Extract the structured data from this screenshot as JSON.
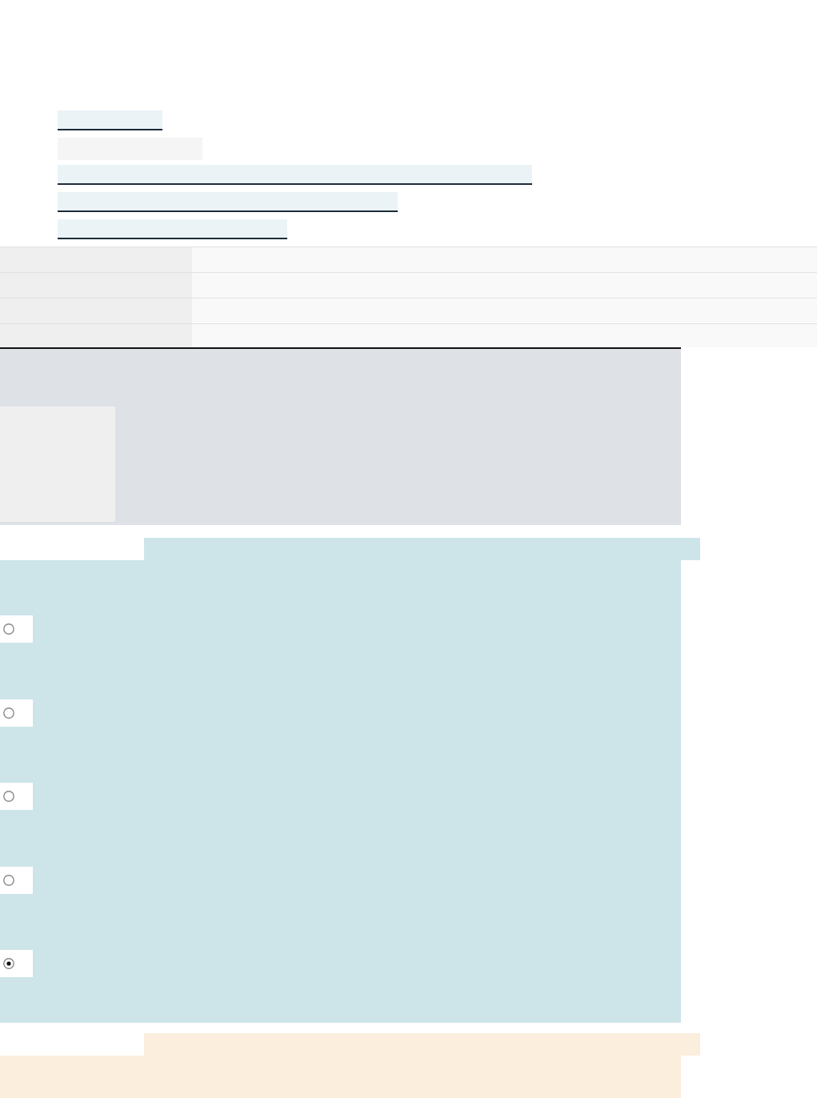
{
  "nav_list": [
    {
      "kind": "link"
    },
    {
      "kind": "plain"
    },
    {
      "kind": "link"
    },
    {
      "kind": "link"
    },
    {
      "kind": "link"
    }
  ],
  "details_table": {
    "rows": [
      {
        "kind": "field"
      },
      {
        "kind": "field"
      },
      {
        "kind": "field"
      },
      {
        "kind": "field"
      }
    ]
  },
  "media_panel": {
    "kind": "image"
  },
  "sections": [
    {
      "kind": "question",
      "options": [
        {
          "selected": false
        },
        {
          "selected": false
        },
        {
          "selected": false
        },
        {
          "selected": false
        },
        {
          "selected": true
        }
      ]
    },
    {
      "kind": "notice"
    }
  ]
}
